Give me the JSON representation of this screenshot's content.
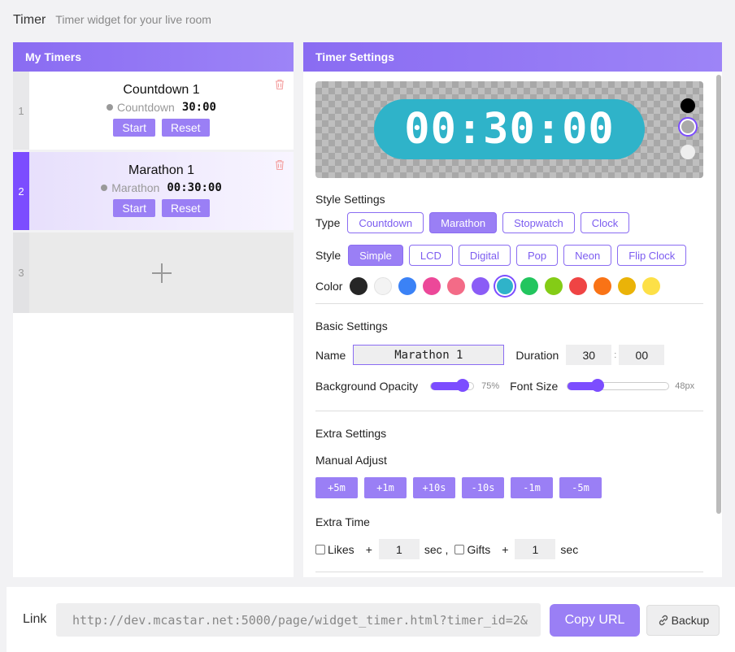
{
  "header": {
    "title": "Timer",
    "subtitle": "Timer widget for your live room"
  },
  "my_timers": {
    "heading": "My Timers",
    "items": [
      {
        "num": "1",
        "name": "Countdown 1",
        "type": "Countdown",
        "time": "30:00",
        "start": "Start",
        "reset": "Reset"
      },
      {
        "num": "2",
        "name": "Marathon 1",
        "type": "Marathon",
        "time": "00:30:00",
        "start": "Start",
        "reset": "Reset"
      }
    ],
    "add_slot_num": "3"
  },
  "settings": {
    "heading": "Timer Settings",
    "preview": {
      "time": "00:30:00",
      "bg_color": "#2fb3c9",
      "options": [
        "#000000",
        "#aaaaaa",
        "#eeeeee"
      ]
    },
    "style_settings": {
      "label": "Style Settings",
      "type_label": "Type",
      "types": [
        "Countdown",
        "Marathon",
        "Stopwatch",
        "Clock"
      ],
      "type_selected": "Marathon",
      "style_label": "Style",
      "styles": [
        "Simple",
        "LCD",
        "Digital",
        "Pop",
        "Neon",
        "Flip Clock"
      ],
      "style_selected": "Simple",
      "color_label": "Color",
      "colors": [
        "#262626",
        "#f3f3f3",
        "#3b82f6",
        "#ec4899",
        "#f36b87",
        "#8b5cf6",
        "#2fb3c9",
        "#22c55e",
        "#84cc16",
        "#ef4444",
        "#f97316",
        "#eab308",
        "#fde047"
      ],
      "color_selected": "#2fb3c9"
    },
    "basic_settings": {
      "label": "Basic Settings",
      "name_label": "Name",
      "name_value": "Marathon 1",
      "duration_label": "Duration",
      "duration_min": "30",
      "duration_sep": ":",
      "duration_sec": "00",
      "opacity_label": "Background Opacity",
      "opacity_value": "75%",
      "opacity_level": 0.75,
      "font_label": "Font Size",
      "font_value": "48px",
      "font_level": 0.3
    },
    "extra_settings": {
      "label": "Extra Settings",
      "manual_label": "Manual Adjust",
      "adjust_buttons": [
        "+5m",
        "+1m",
        "+10s",
        "-10s",
        "-1m",
        "-5m"
      ],
      "extra_time_label": "Extra Time",
      "likes_label": "Likes",
      "plus": "+",
      "likes_value": "1",
      "sec_comma": "sec ,",
      "gifts_label": "Gifts",
      "gifts_value": "1",
      "sec": "sec"
    }
  },
  "bottom": {
    "link_label": "Link",
    "link_value": "http://dev.mcastar.net:5000/page/widget_timer.html?timer_id=2&",
    "copy_label": "Copy URL",
    "backup_label": "Backup"
  }
}
